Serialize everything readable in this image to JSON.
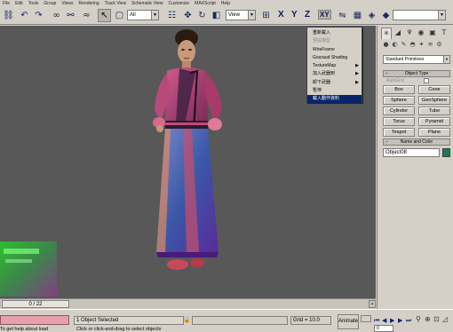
{
  "menubar": {
    "items": [
      "File",
      "Edit",
      "Tools",
      "Group",
      "Views",
      "Rendering",
      "Track View",
      "Schematic View",
      "Customize",
      "MAXScript",
      "Help"
    ]
  },
  "toolbar": {
    "selection_filter": "All",
    "ref_coord": "View",
    "axes": [
      "X",
      "Y",
      "Z",
      "XY"
    ],
    "named_selection": ""
  },
  "viewport": {
    "label": ""
  },
  "context_menu": {
    "items": [
      {
        "label": "重新載入",
        "disabled": false,
        "submenu": false
      },
      {
        "label": "預設模型",
        "disabled": true,
        "submenu": false
      },
      {
        "label": "WireFrame",
        "disabled": false,
        "submenu": false
      },
      {
        "label": "Gouraud Shading",
        "disabled": false,
        "submenu": false
      },
      {
        "label": "TextureMap",
        "disabled": false,
        "submenu": true
      },
      {
        "label": "加入武器到",
        "disabled": false,
        "submenu": true
      },
      {
        "label": "卸下武器",
        "disabled": false,
        "submenu": true
      },
      {
        "label": "暫停",
        "disabled": false,
        "submenu": false
      },
      {
        "label": "載入動作資料",
        "disabled": false,
        "submenu": false,
        "selected": true
      }
    ]
  },
  "time_slider": {
    "frame": "0 / 22",
    "max": 22,
    "current": 0
  },
  "command_panel": {
    "category": "Standard Primitives",
    "object_type_title": "Object Type",
    "autogrid_label": "AutoGrid",
    "buttons": [
      "Box",
      "Cone",
      "Sphere",
      "GeoSphere",
      "Cylinder",
      "Tube",
      "Torus",
      "Pyramid",
      "Teapot",
      "Plane"
    ],
    "name_color_title": "Name and Color",
    "object_name": "Object08",
    "object_color": "#1a7a5a"
  },
  "status": {
    "selection": "1 Object Selected",
    "grid": "Grid = 10.0",
    "prompt": "To get help about load",
    "hint": "Click or click-and-drag to select objects",
    "animate": "Animate",
    "frame": "0"
  }
}
